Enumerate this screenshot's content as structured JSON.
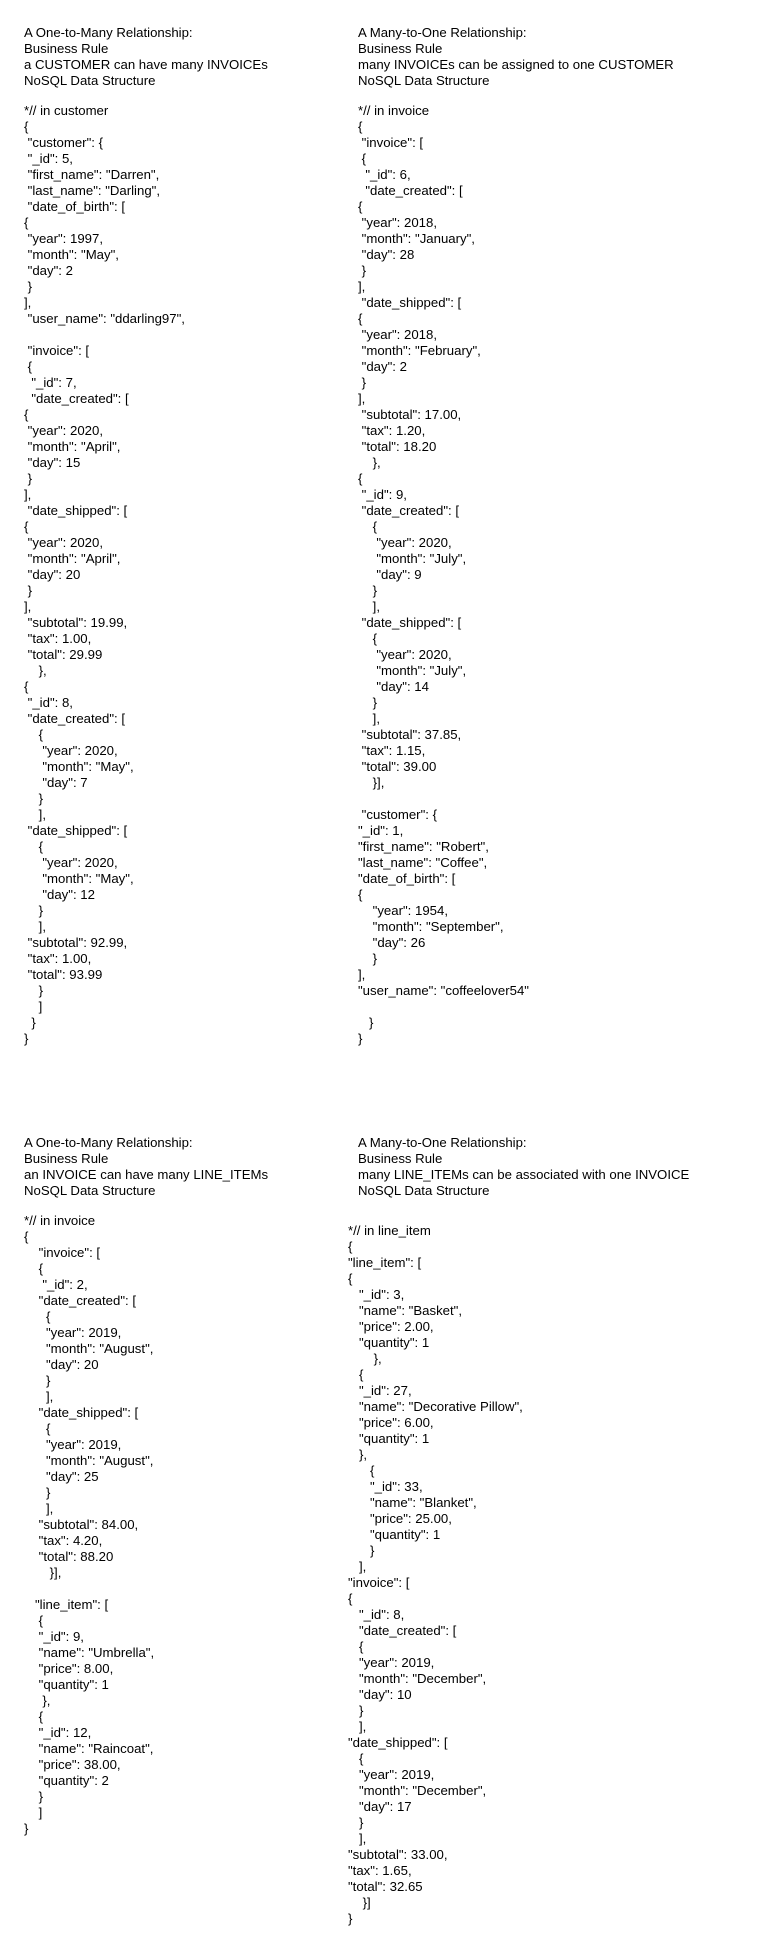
{
  "panels": [
    {
      "header": [
        "A One-to-Many Relationship:",
        "Business Rule",
        "a CUSTOMER can have many INVOICEs",
        "NoSQL Data Structure"
      ],
      "code": "*// in customer\n{\n \"customer\": {\n \"_id\": 5,\n \"first_name\": \"Darren\",\n \"last_name\": \"Darling\",\n \"date_of_birth\": [\n{\n \"year\": 1997,\n \"month\": \"May\",\n \"day\": 2\n }\n],\n \"user_name\": \"ddarling97\",\n\n \"invoice\": [\n {\n  \"_id\": 7,\n  \"date_created\": [\n{\n \"year\": 2020,\n \"month\": \"April\",\n \"day\": 15\n }\n],\n \"date_shipped\": [\n{\n \"year\": 2020,\n \"month\": \"April\",\n \"day\": 20\n }\n],\n \"subtotal\": 19.99,\n \"tax\": 1.00,\n \"total\": 29.99\n    },\n{\n \"_id\": 8,\n \"date_created\": [\n    {\n     \"year\": 2020,\n     \"month\": \"May\",\n     \"day\": 7\n    }\n    ],\n \"date_shipped\": [\n    {\n     \"year\": 2020,\n     \"month\": \"May\",\n     \"day\": 12\n    }\n    ],\n \"subtotal\": 92.99,\n \"tax\": 1.00,\n \"total\": 93.99\n    }\n    ]\n  }\n}"
    },
    {
      "header": [
        "A Many-to-One Relationship:",
        "Business Rule",
        "many INVOICEs can be assigned to one CUSTOMER",
        "NoSQL Data Structure"
      ],
      "code": "*// in invoice\n{\n \"invoice\": [\n {\n  \"_id\": 6,\n  \"date_created\": [\n{\n \"year\": 2018,\n \"month\": \"January\",\n \"day\": 28\n }\n],\n \"date_shipped\": [\n{\n \"year\": 2018,\n \"month\": \"February\",\n \"day\": 2\n }\n],\n \"subtotal\": 17.00,\n \"tax\": 1.20,\n \"total\": 18.20\n    },\n{\n \"_id\": 9,\n \"date_created\": [\n    {\n     \"year\": 2020,\n     \"month\": \"July\",\n     \"day\": 9\n    }\n    ],\n \"date_shipped\": [\n    {\n     \"year\": 2020,\n     \"month\": \"July\",\n     \"day\": 14\n    }\n    ],\n \"subtotal\": 37.85,\n \"tax\": 1.15,\n \"total\": 39.00\n    }],\n\n \"customer\": {\n\"_id\": 1,\n\"first_name\": \"Robert\",\n\"last_name\": \"Coffee\",\n\"date_of_birth\": [\n{\n    \"year\": 1954,\n    \"month\": \"September\",\n    \"day\": 26\n    }\n],\n\"user_name\": \"coffeelover54\"\n\n   }\n}"
    },
    {
      "header": [
        "A One-to-Many Relationship:",
        "Business Rule",
        "an INVOICE can have many LINE_ITEMs",
        "NoSQL Data Structure"
      ],
      "code": "*// in invoice\n{\n    \"invoice\": [\n    {\n     \"_id\": 2,\n    \"date_created\": [\n      {\n      \"year\": 2019,\n      \"month\": \"August\",\n      \"day\": 20\n      }\n      ],\n    \"date_shipped\": [\n      {\n      \"year\": 2019,\n      \"month\": \"August\",\n      \"day\": 25\n      }\n      ],\n    \"subtotal\": 84.00,\n    \"tax\": 4.20,\n    \"total\": 88.20\n       }],\n\n   \"line_item\": [\n    {\n    \"_id\": 9,\n    \"name\": \"Umbrella\",\n    \"price\": 8.00,\n    \"quantity\": 1\n     },\n    {\n    \"_id\": 12,\n    \"name\": \"Raincoat\",\n    \"price\": 38.00,\n    \"quantity\": 2\n    }\n    ]\n}"
    },
    {
      "header": [
        "A Many-to-One Relationship:",
        "Business Rule",
        "many LINE_ITEMs can be associated with one INVOICE",
        "NoSQL Data Structure"
      ],
      "code": "*// in line_item\n{\n\"line_item\": [\n{\n   \"_id\": 3,\n   \"name\": \"Basket\",\n   \"price\": 2.00,\n   \"quantity\": 1\n       },\n   {\n   \"_id\": 27,\n   \"name\": \"Decorative Pillow\",\n   \"price\": 6.00,\n   \"quantity\": 1\n   },\n      {\n      \"_id\": 33,\n      \"name\": \"Blanket\",\n      \"price\": 25.00,\n      \"quantity\": 1\n      }\n   ],\n\"invoice\": [\n{\n   \"_id\": 8,\n   \"date_created\": [\n   {\n   \"year\": 2019,\n   \"month\": \"December\",\n   \"day\": 10\n   }\n   ],\n\"date_shipped\": [\n   {\n   \"year\": 2019,\n   \"month\": \"December\",\n   \"day\": 17\n   }\n   ],\n\"subtotal\": 33.00,\n\"tax\": 1.65,\n\"total\": 32.65\n    }]\n}"
    }
  ]
}
